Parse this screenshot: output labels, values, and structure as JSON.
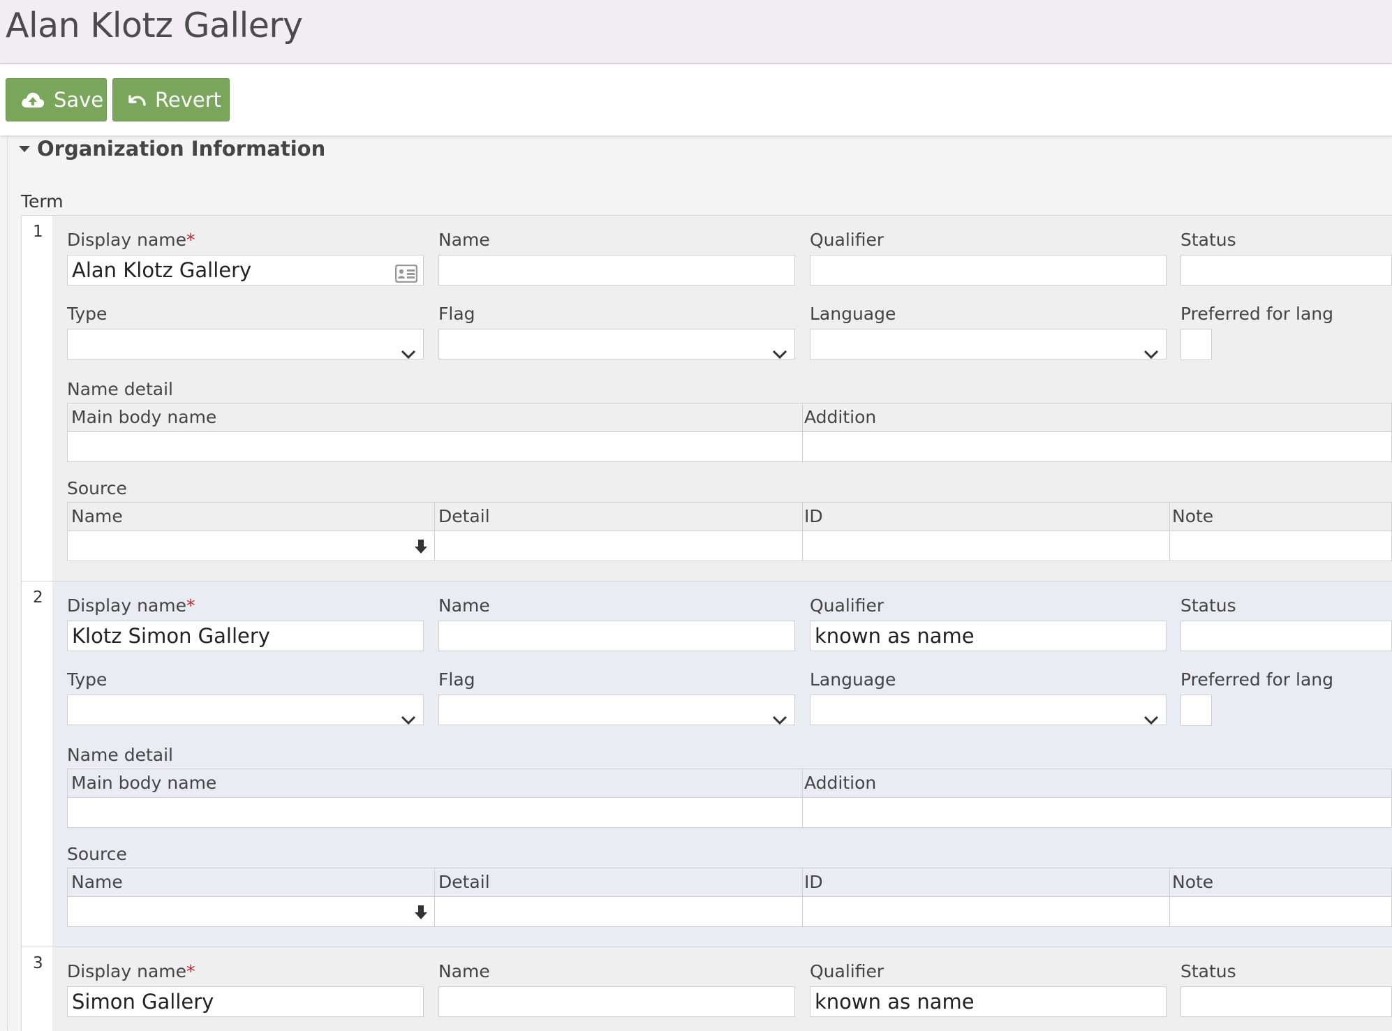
{
  "page": {
    "title": "Alan Klotz Gallery"
  },
  "toolbar": {
    "save_label": "Save",
    "revert_label": "Revert"
  },
  "section": {
    "title": "Organization Information",
    "term_label": "Term"
  },
  "labels": {
    "display_name": "Display name",
    "required_mark": "*",
    "name": "Name",
    "qualifier": "Qualifier",
    "status": "Status",
    "type": "Type",
    "flag": "Flag",
    "language": "Language",
    "preferred_for_lang": "Preferred for lang",
    "name_detail": "Name detail",
    "main_body_name": "Main body name",
    "addition": "Addition",
    "source": "Source",
    "source_name": "Name",
    "source_detail": "Detail",
    "source_id": "ID",
    "source_note": "Note"
  },
  "terms": [
    {
      "number": "1",
      "display_name": "Alan Klotz Gallery",
      "name": "",
      "qualifier": "",
      "status": ""
    },
    {
      "number": "2",
      "display_name": "Klotz Simon Gallery",
      "name": "",
      "qualifier": "known as name",
      "status": ""
    },
    {
      "number": "3",
      "display_name": "Simon Gallery",
      "name": "",
      "qualifier": "known as name",
      "status": ""
    }
  ]
}
